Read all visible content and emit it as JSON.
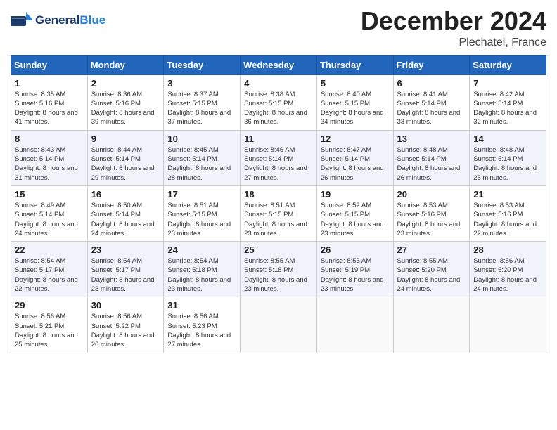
{
  "header": {
    "logo_general": "General",
    "logo_blue": "Blue",
    "month_title": "December 2024",
    "location": "Plechatel, France"
  },
  "weekdays": [
    "Sunday",
    "Monday",
    "Tuesday",
    "Wednesday",
    "Thursday",
    "Friday",
    "Saturday"
  ],
  "weeks": [
    [
      {
        "day": 1,
        "sunrise": "8:35 AM",
        "sunset": "5:16 PM",
        "daylight": "8 hours and 41 minutes."
      },
      {
        "day": 2,
        "sunrise": "8:36 AM",
        "sunset": "5:16 PM",
        "daylight": "8 hours and 39 minutes."
      },
      {
        "day": 3,
        "sunrise": "8:37 AM",
        "sunset": "5:15 PM",
        "daylight": "8 hours and 37 minutes."
      },
      {
        "day": 4,
        "sunrise": "8:38 AM",
        "sunset": "5:15 PM",
        "daylight": "8 hours and 36 minutes."
      },
      {
        "day": 5,
        "sunrise": "8:40 AM",
        "sunset": "5:15 PM",
        "daylight": "8 hours and 34 minutes."
      },
      {
        "day": 6,
        "sunrise": "8:41 AM",
        "sunset": "5:14 PM",
        "daylight": "8 hours and 33 minutes."
      },
      {
        "day": 7,
        "sunrise": "8:42 AM",
        "sunset": "5:14 PM",
        "daylight": "8 hours and 32 minutes."
      }
    ],
    [
      {
        "day": 8,
        "sunrise": "8:43 AM",
        "sunset": "5:14 PM",
        "daylight": "8 hours and 31 minutes."
      },
      {
        "day": 9,
        "sunrise": "8:44 AM",
        "sunset": "5:14 PM",
        "daylight": "8 hours and 29 minutes."
      },
      {
        "day": 10,
        "sunrise": "8:45 AM",
        "sunset": "5:14 PM",
        "daylight": "8 hours and 28 minutes."
      },
      {
        "day": 11,
        "sunrise": "8:46 AM",
        "sunset": "5:14 PM",
        "daylight": "8 hours and 27 minutes."
      },
      {
        "day": 12,
        "sunrise": "8:47 AM",
        "sunset": "5:14 PM",
        "daylight": "8 hours and 26 minutes."
      },
      {
        "day": 13,
        "sunrise": "8:48 AM",
        "sunset": "5:14 PM",
        "daylight": "8 hours and 26 minutes."
      },
      {
        "day": 14,
        "sunrise": "8:48 AM",
        "sunset": "5:14 PM",
        "daylight": "8 hours and 25 minutes."
      }
    ],
    [
      {
        "day": 15,
        "sunrise": "8:49 AM",
        "sunset": "5:14 PM",
        "daylight": "8 hours and 24 minutes."
      },
      {
        "day": 16,
        "sunrise": "8:50 AM",
        "sunset": "5:14 PM",
        "daylight": "8 hours and 24 minutes."
      },
      {
        "day": 17,
        "sunrise": "8:51 AM",
        "sunset": "5:15 PM",
        "daylight": "8 hours and 23 minutes."
      },
      {
        "day": 18,
        "sunrise": "8:51 AM",
        "sunset": "5:15 PM",
        "daylight": "8 hours and 23 minutes."
      },
      {
        "day": 19,
        "sunrise": "8:52 AM",
        "sunset": "5:15 PM",
        "daylight": "8 hours and 23 minutes."
      },
      {
        "day": 20,
        "sunrise": "8:53 AM",
        "sunset": "5:16 PM",
        "daylight": "8 hours and 23 minutes."
      },
      {
        "day": 21,
        "sunrise": "8:53 AM",
        "sunset": "5:16 PM",
        "daylight": "8 hours and 22 minutes."
      }
    ],
    [
      {
        "day": 22,
        "sunrise": "8:54 AM",
        "sunset": "5:17 PM",
        "daylight": "8 hours and 22 minutes."
      },
      {
        "day": 23,
        "sunrise": "8:54 AM",
        "sunset": "5:17 PM",
        "daylight": "8 hours and 23 minutes."
      },
      {
        "day": 24,
        "sunrise": "8:54 AM",
        "sunset": "5:18 PM",
        "daylight": "8 hours and 23 minutes."
      },
      {
        "day": 25,
        "sunrise": "8:55 AM",
        "sunset": "5:18 PM",
        "daylight": "8 hours and 23 minutes."
      },
      {
        "day": 26,
        "sunrise": "8:55 AM",
        "sunset": "5:19 PM",
        "daylight": "8 hours and 23 minutes."
      },
      {
        "day": 27,
        "sunrise": "8:55 AM",
        "sunset": "5:20 PM",
        "daylight": "8 hours and 24 minutes."
      },
      {
        "day": 28,
        "sunrise": "8:56 AM",
        "sunset": "5:20 PM",
        "daylight": "8 hours and 24 minutes."
      }
    ],
    [
      {
        "day": 29,
        "sunrise": "8:56 AM",
        "sunset": "5:21 PM",
        "daylight": "8 hours and 25 minutes."
      },
      {
        "day": 30,
        "sunrise": "8:56 AM",
        "sunset": "5:22 PM",
        "daylight": "8 hours and 26 minutes."
      },
      {
        "day": 31,
        "sunrise": "8:56 AM",
        "sunset": "5:23 PM",
        "daylight": "8 hours and 27 minutes."
      },
      null,
      null,
      null,
      null
    ]
  ],
  "labels": {
    "sunrise": "Sunrise:",
    "sunset": "Sunset:",
    "daylight": "Daylight:"
  }
}
